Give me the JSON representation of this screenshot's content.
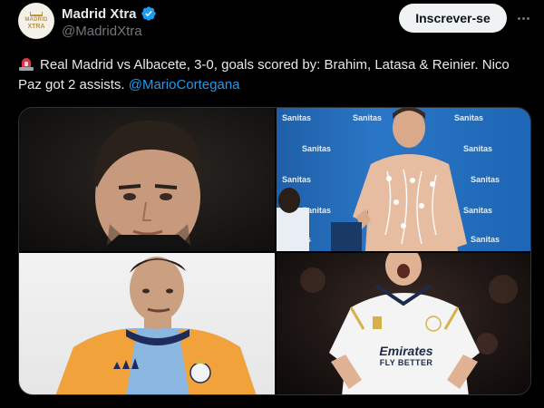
{
  "account": {
    "display_name": "Madrid Xtra",
    "handle": "@MadridXtra",
    "avatar_line1": "MADRID",
    "avatar_line2": "XTRA"
  },
  "actions": {
    "subscribe_label": "Inscrever-se",
    "more_icon": "more-horizontal-icon"
  },
  "tweet": {
    "text": "Real Madrid vs Albacete, 3-0, goals scored by: Brahim, Latasa & Reinier. Nico Paz got 2 assists.",
    "mention": "@MarioCortegana",
    "emoji": "siren-icon"
  },
  "media": {
    "photo2_wall_text": "Sanitas",
    "photo4_shirt_line1": "Emirates",
    "photo4_shirt_line2": "FLY BETTER"
  },
  "colors": {
    "accent": "#1d9bf0",
    "background": "#000000",
    "text_primary": "#e7e9ea",
    "text_secondary": "#71767b"
  }
}
